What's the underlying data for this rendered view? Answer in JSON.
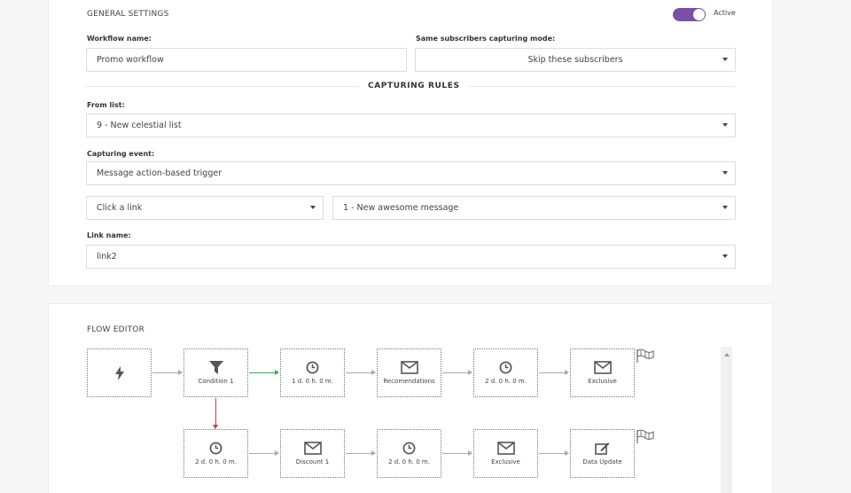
{
  "general": {
    "title": "GENERAL SETTINGS",
    "active_label": "Active",
    "active": true,
    "accent_color": "#7b4fa5",
    "workflow_name_label": "Workflow name:",
    "workflow_name_value": "Promo workflow",
    "same_subscribers_label": "Same subscribers capturing mode:",
    "same_subscribers_value": "Skip these subscribers",
    "capturing_rules_title": "CAPTURING RULES",
    "from_list_label": "From list:",
    "from_list_value": "9 - New celestial list",
    "capturing_event_label": "Capturing event:",
    "capturing_event_value": "Message action-based trigger",
    "action_value": "Click a link",
    "message_value": "1 - New awesome message",
    "link_name_label": "Link name:",
    "link_name_value": "link2"
  },
  "flow": {
    "title": "FLOW EDITOR",
    "row1": [
      {
        "icon": "lightning-icon",
        "label": ""
      },
      {
        "icon": "filter-icon",
        "label": "Condition 1"
      },
      {
        "icon": "clock-icon",
        "label": "1 d. 0 h. 0 m."
      },
      {
        "icon": "envelope-icon",
        "label": "Recomendations"
      },
      {
        "icon": "clock-icon",
        "label": "2 d. 0 h. 0 m."
      },
      {
        "icon": "envelope-icon",
        "label": "Exclusive"
      }
    ],
    "row2": [
      {
        "icon": "clock-icon",
        "label": "2 d. 0 h. 0 m."
      },
      {
        "icon": "envelope-icon",
        "label": "Discount 1"
      },
      {
        "icon": "clock-icon",
        "label": "2 d. 0 h. 0 m."
      },
      {
        "icon": "envelope-icon",
        "label": "Exclusive"
      },
      {
        "icon": "edit-icon",
        "label": "Data Update"
      }
    ],
    "true_color": "#3cb04a",
    "false_color": "#d83a3a"
  }
}
